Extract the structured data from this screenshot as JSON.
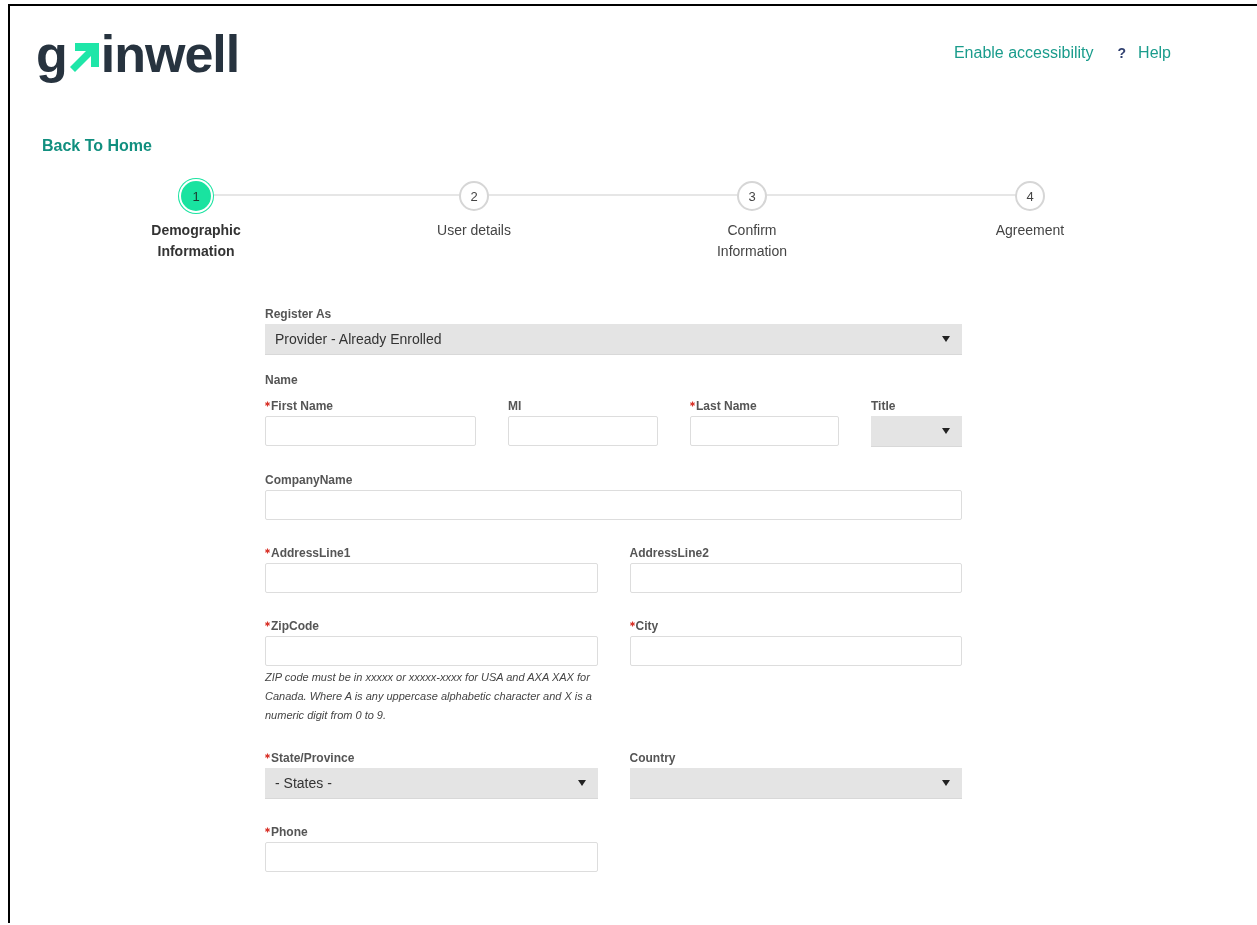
{
  "header": {
    "logo_start": "g",
    "logo_end": "inwell",
    "links": [
      {
        "kind": "link",
        "label": "Enable accessibility"
      },
      {
        "kind": "help",
        "icon": "?",
        "label": "Help"
      }
    ]
  },
  "back_link": "Back To Home",
  "steps": [
    {
      "number": "1",
      "label": "Demographic Information",
      "selected": true
    },
    {
      "number": "2",
      "label": "User details",
      "selected": false
    },
    {
      "number": "3",
      "label": "Confirm Information",
      "selected": false
    },
    {
      "number": "4",
      "label": "Agreement",
      "selected": false
    }
  ],
  "form": [
    {
      "kind": "full",
      "fields": [
        {
          "kind": "select",
          "label": "Register As",
          "required": false,
          "value": "Provider - Already Enrolled"
        }
      ]
    },
    {
      "kind": "heading",
      "text": "Name"
    },
    {
      "kind": "quad",
      "fields": [
        {
          "kind": "text",
          "label": "First Name",
          "required": true
        },
        {
          "kind": "text",
          "label": "MI",
          "required": false
        },
        {
          "kind": "text",
          "label": "Last Name",
          "required": true
        },
        {
          "kind": "select",
          "label": "Title",
          "required": false
        }
      ]
    },
    {
      "kind": "full",
      "fields": [
        {
          "kind": "text",
          "label": "CompanyName",
          "required": false
        }
      ]
    },
    {
      "kind": "pair",
      "fields": [
        {
          "kind": "text",
          "label": "AddressLine1",
          "required": true
        },
        {
          "kind": "text",
          "label": "AddressLine2",
          "required": false
        }
      ]
    },
    {
      "kind": "pair",
      "fields": [
        {
          "kind": "text",
          "label": "ZipCode",
          "required": true,
          "help": "ZIP code must be in xxxxx or xxxxx-xxxx for USA and AXA XAX for Canada. Where A is any uppercase alphabetic character and X is a numeric digit from 0 to 9."
        },
        {
          "kind": "text",
          "label": "City",
          "required": true
        }
      ]
    },
    {
      "kind": "pair",
      "fields": [
        {
          "kind": "select",
          "label": "State/Province",
          "required": true,
          "value": "- States -"
        },
        {
          "kind": "select",
          "label": "Country",
          "required": false
        }
      ]
    },
    {
      "kind": "pair",
      "fields": [
        {
          "kind": "text",
          "label": "Phone",
          "required": true
        }
      ]
    }
  ]
}
